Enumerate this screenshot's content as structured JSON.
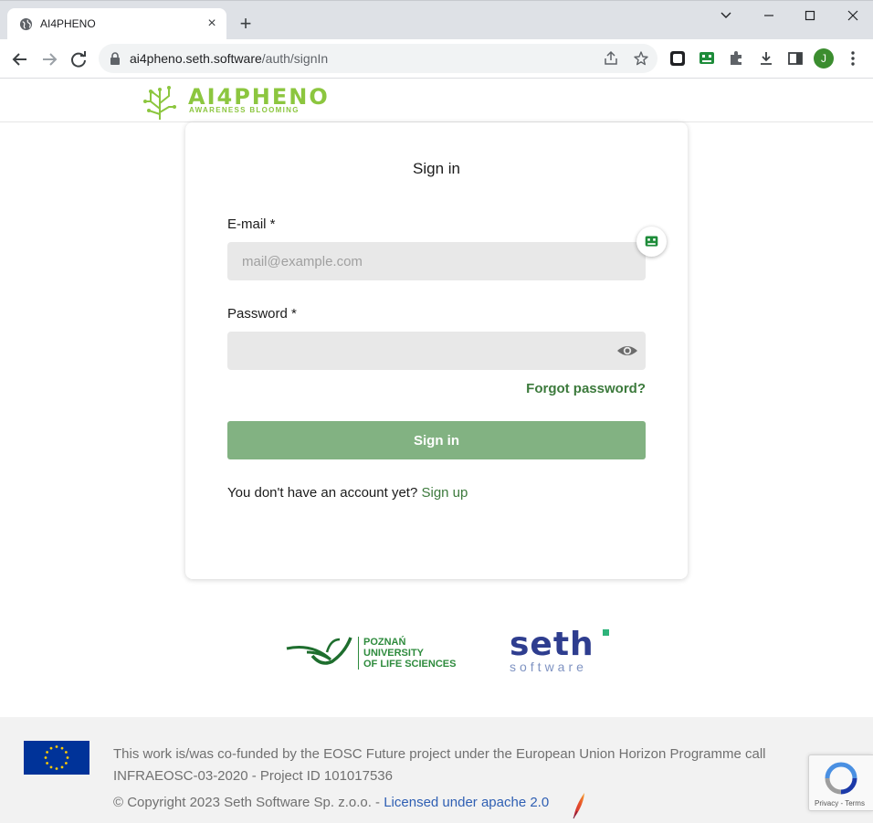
{
  "browser": {
    "tab_title": "AI4PHENO",
    "url_host": "ai4pheno.seth.software",
    "url_path": "/auth/signIn",
    "profile_initial": "J"
  },
  "header": {
    "logo_name": "AI4PHENO",
    "logo_tagline": "AWARENESS BLOOMING"
  },
  "signin": {
    "title": "Sign in",
    "email_label": "E-mail *",
    "email_placeholder": "mail@example.com",
    "password_label": "Password *",
    "forgot_link": "Forgot password?",
    "submit_label": "Sign in",
    "no_account_text": "You don't have an account yet? ",
    "signup_link": "Sign up"
  },
  "partners": {
    "pul_lines": [
      "POZNAŃ",
      "UNIVERSITY",
      "OF LIFE SCIENCES"
    ],
    "seth_name": "seth",
    "seth_sub": "software"
  },
  "footer": {
    "funding_text": "This work is/was co-funded by the EOSC Future project under the European Union Horizon Programme call INFRAEOSC-03-2020 - Project ID 101017536",
    "copyright_text": "© Copyright 2023 Seth Software Sp. z.o.o. - ",
    "license_link": "Licensed under apache 2.0",
    "recaptcha_links": "Privacy - Terms"
  },
  "colors": {
    "brand_green": "#8cc63f",
    "link_green": "#3c7a3c",
    "button_green": "#82b282",
    "seth_blue": "#2e3d8f",
    "eu_blue": "#003399"
  }
}
